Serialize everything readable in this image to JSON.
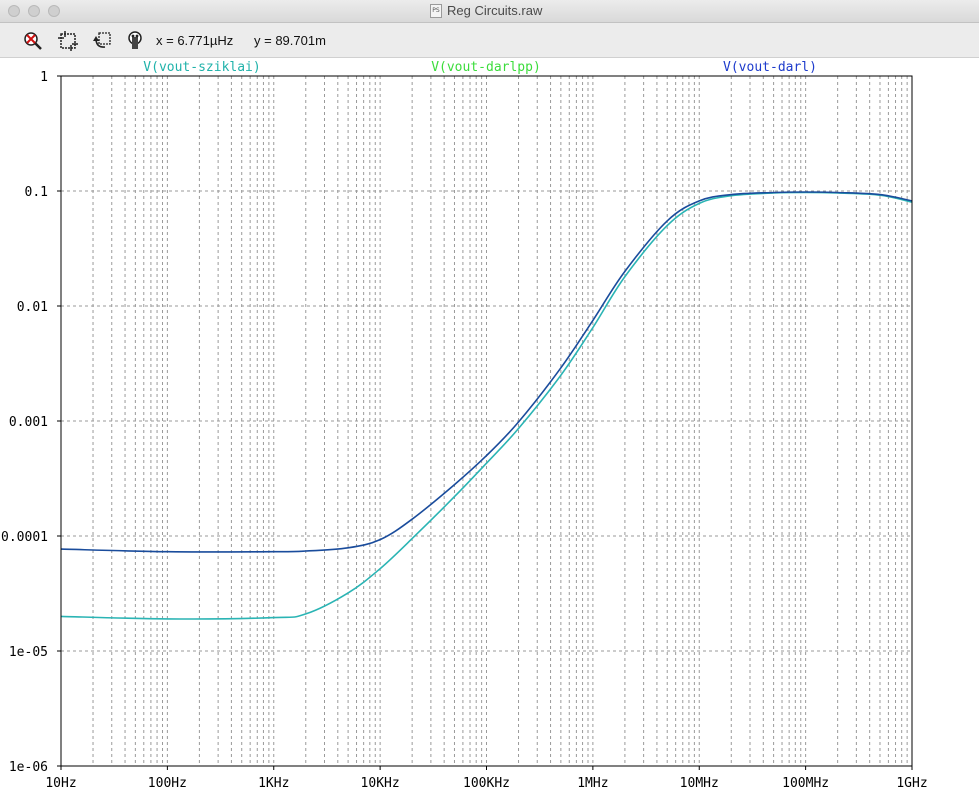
{
  "window": {
    "title": "Reg Circuits.raw",
    "file_icon_text": "PS"
  },
  "toolbar": {
    "buttons": [
      {
        "name": "zoom-to-fit-icon"
      },
      {
        "name": "zoom-area-icon"
      },
      {
        "name": "undo-zoom-icon"
      },
      {
        "name": "probe-icon"
      }
    ],
    "cursor_x": "x = 6.771µHz",
    "cursor_y": "y = 89.701m"
  },
  "colors": {
    "background": "#ffffff",
    "grid": "#9a9a9a",
    "axis": "#000000",
    "sziklai": "#20b2aa",
    "darlpp": "#3cdc3c",
    "darl": "#1e3ccc",
    "trace_sziklai": "#2ab4b4",
    "trace_darl": "#1a4c9c"
  },
  "chart_data": {
    "type": "line",
    "xscale": "log",
    "yscale": "log",
    "xlim": [
      10,
      1000000000
    ],
    "ylim": [
      1e-06,
      1
    ],
    "grid": true,
    "legend_placement": "top",
    "x_tick_labels": [
      "10Hz",
      "100Hz",
      "1KHz",
      "10KHz",
      "100KHz",
      "1MHz",
      "10MHz",
      "100MHz",
      "1GHz"
    ],
    "x_tick_values": [
      10,
      100,
      1000,
      10000,
      100000,
      1000000,
      10000000,
      100000000,
      1000000000
    ],
    "y_tick_labels": [
      "1",
      "0.1",
      "0.01",
      "0.001",
      "0.0001",
      "1e-05",
      "1e-06"
    ],
    "y_tick_values": [
      1,
      0.1,
      0.01,
      0.001,
      0.0001,
      1e-05,
      1e-06
    ],
    "legend": [
      "V(vout-sziklai)",
      "V(vout-darlpp)",
      "V(vout-darl)"
    ],
    "series": [
      {
        "name": "V(vout-sziklai)",
        "color": "#2ab4b4",
        "x": [
          10,
          100,
          1000,
          2000,
          5000,
          10000,
          20000,
          50000,
          100000,
          200000,
          500000,
          1000000,
          2000000,
          5000000,
          10000000,
          20000000,
          50000000,
          100000000,
          200000000,
          500000000,
          1000000000
        ],
        "y": [
          2e-05,
          1.9e-05,
          1.95e-05,
          2.1e-05,
          3.2e-05,
          5.2e-05,
          9.5e-05,
          0.00022,
          0.00043,
          0.00086,
          0.0025,
          0.0065,
          0.018,
          0.05,
          0.078,
          0.091,
          0.096,
          0.097,
          0.096,
          0.092,
          0.08
        ]
      },
      {
        "name": "V(vout-darl)",
        "color": "#1a4c9c",
        "x": [
          10,
          100,
          1000,
          2000,
          5000,
          10000,
          20000,
          50000,
          100000,
          200000,
          500000,
          1000000,
          2000000,
          5000000,
          10000000,
          20000000,
          50000000,
          100000000,
          200000000,
          500000000,
          1000000000
        ],
        "y": [
          7.7e-05,
          7.3e-05,
          7.3e-05,
          7.4e-05,
          7.9e-05,
          9.3e-05,
          0.00014,
          0.00028,
          0.0005,
          0.00098,
          0.0029,
          0.0075,
          0.02,
          0.055,
          0.082,
          0.093,
          0.097,
          0.098,
          0.097,
          0.093,
          0.082
        ]
      }
    ]
  }
}
